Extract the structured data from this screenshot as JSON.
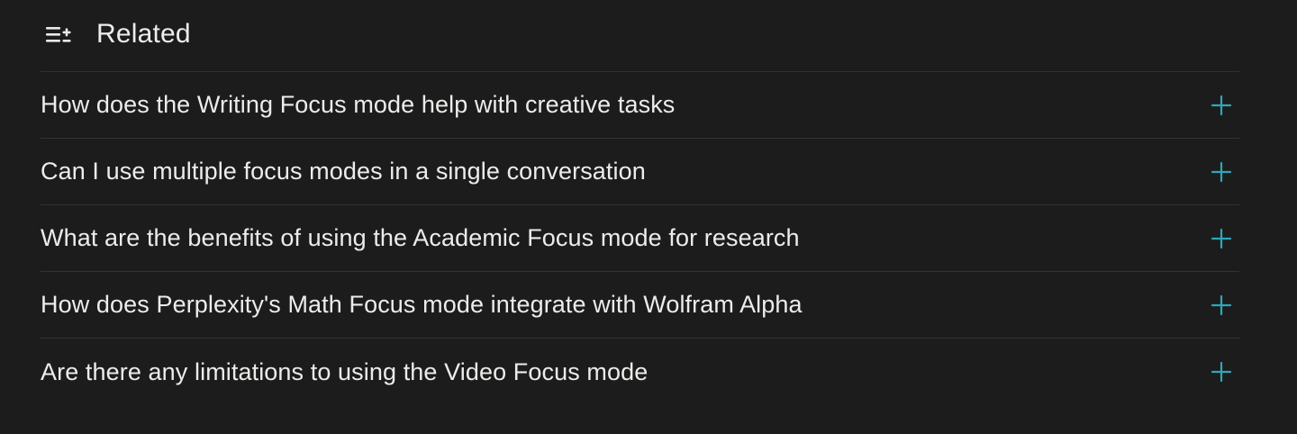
{
  "related": {
    "title": "Related",
    "header_icon": "list-plus-icon",
    "accent_color": "#2fa6b8",
    "items": [
      {
        "label": "How does the Writing Focus mode help with creative tasks",
        "icon": "plus-icon"
      },
      {
        "label": "Can I use multiple focus modes in a single conversation",
        "icon": "plus-icon"
      },
      {
        "label": "What are the benefits of using the Academic Focus mode for research",
        "icon": "plus-icon"
      },
      {
        "label": "How does Perplexity's Math Focus mode integrate with Wolfram Alpha",
        "icon": "plus-icon"
      },
      {
        "label": "Are there any limitations to using the Video Focus mode",
        "icon": "plus-icon"
      }
    ]
  }
}
